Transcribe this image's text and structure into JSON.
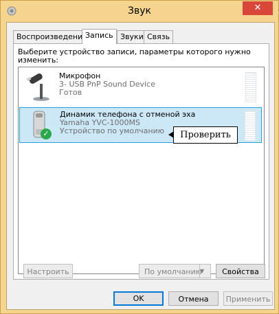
{
  "window": {
    "title": "Звук",
    "close_glyph": "✕"
  },
  "tabs": [
    {
      "label": "Воспроизведение"
    },
    {
      "label": "Запись"
    },
    {
      "label": "Звуки"
    },
    {
      "label": "Связь"
    }
  ],
  "panel": {
    "instruction": "Выберите устройство записи, параметры которого нужно изменить:"
  },
  "devices": [
    {
      "name": "Микрофон",
      "sub": "3- USB PnP Sound Device",
      "status": "Готов",
      "icon": "microphone-icon"
    },
    {
      "name": "Динамик телефона с отменой эха",
      "sub": "Yamaha YVC-1000MS",
      "status": "Устройство по умолчанию",
      "icon": "speakerphone-icon",
      "default_badge": "✓"
    }
  ],
  "tooltip": {
    "text": "Проверить"
  },
  "buttons": {
    "configure": "Настроить",
    "set_default": "По умолчанию",
    "properties": "Свойства",
    "ok": "OK",
    "cancel": "Отмена",
    "apply": "Применить"
  },
  "colors": {
    "selection": "#cce8f7",
    "close": "#d9463a",
    "frame": "#f5d48f"
  }
}
